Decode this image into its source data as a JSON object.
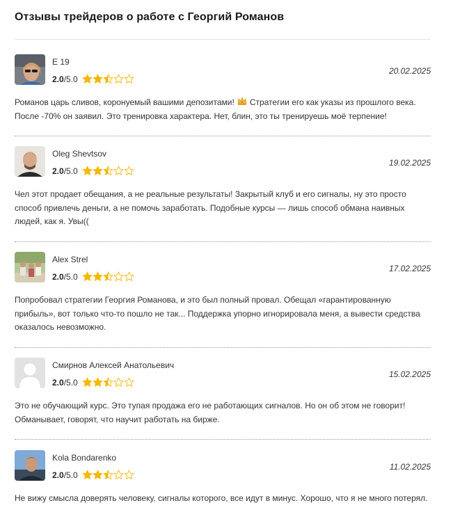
{
  "page": {
    "title": "Отзывы трейдеров о работе с Георгий Романов"
  },
  "colors": {
    "star": "#f5b800",
    "star_empty": "#f5b800",
    "separator": "#999999"
  },
  "reviews": [
    {
      "name": "E 19",
      "rating": "2.0",
      "rating_max": "/5.0",
      "stars_value": 2.5,
      "date": "20.02.2025",
      "avatar": "photo-woman-sunglasses",
      "text_before": "Романов царь сливов, коронуемый вашими депозитами!",
      "emoji": "crown-icon",
      "text_after": "Стратегии его как указы из прошлого века. После -70% он заявил. Это тренировка характера. Нет, блин, это ты тренируешь моё терпение!"
    },
    {
      "name": "Oleg Shevtsov",
      "rating": "2.0",
      "rating_max": "/5.0",
      "stars_value": 2.5,
      "date": "19.02.2025",
      "avatar": "photo-man",
      "text": "Чел этот продает обещания, а не реальные результаты! Закрытый клуб и его сигналы, ну это просто способ привлечь деньги, а не помочь заработать. Подобные курсы — лишь способ обмана наивных людей, как я. Увы(("
    },
    {
      "name": "Alex Strel",
      "rating": "2.0",
      "rating_max": "/5.0",
      "stars_value": 2.5,
      "date": "17.02.2025",
      "avatar": "photo-group-outdoor",
      "text": "Попробовал стратегии Георгия Романова, и это был полный провал. Обещал «гарантированную прибыль», вот только что-то пошло не так... Поддержка упорно игнорировала меня, а вывести средства оказалось невозможно."
    },
    {
      "name": "Смирнов Алексей Анатольевич",
      "rating": "2.0",
      "rating_max": "/5.0",
      "stars_value": 2.5,
      "date": "15.02.2025",
      "avatar": "default-user-avatar",
      "text": "Это не обучающий курс. Это тупая продажа его не работающих сигналов. Но он об этом не говорит! Обманывает, говорят, что научит работать на бирже."
    },
    {
      "name": "Kola Bondarenko",
      "rating": "2.0",
      "rating_max": "/5.0",
      "stars_value": 2.5,
      "date": "11.02.2025",
      "avatar": "photo-man-sky",
      "text": "Не вижу смысла доверять человеку, сигналы которого, все идут в минус. Хорошо, что я не много потерял."
    }
  ]
}
